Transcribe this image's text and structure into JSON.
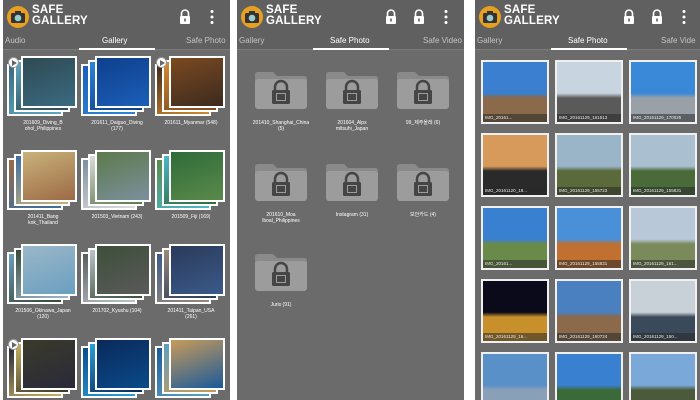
{
  "screens": [
    {
      "app_title": "SAFE\nGALLERY",
      "icons": [
        "app-logo-icon",
        "lock-icon",
        "more-vert-icon"
      ],
      "tabs": [
        "Audio",
        "Gallery",
        "Safe Photo"
      ],
      "active_tab": 1,
      "albums": [
        {
          "caption": "201609_Diving_B\nohol_Philippines",
          "video": true,
          "colors": [
            "#3a6a82",
            "#5fa7c0",
            "#2f4a52"
          ]
        },
        {
          "caption": "201611_Daiguo_Diving\n(177)",
          "video": false,
          "colors": [
            "#1b5fb8",
            "#2b86d6",
            "#0f3f8c"
          ]
        },
        {
          "caption": "201611_Myanmar (548)",
          "video": true,
          "colors": [
            "#3c2a1f",
            "#d48a2e",
            "#7b4a20"
          ]
        },
        {
          "caption": "201411_Bang\nkok_Thailand",
          "video": false,
          "colors": [
            "#9c6a45",
            "#3b6fa0",
            "#c9b27a"
          ]
        },
        {
          "caption": "201503_Vietnam (243)",
          "video": false,
          "colors": [
            "#7c8f9d",
            "#dcdcdc",
            "#5c7a4b"
          ]
        },
        {
          "caption": "201509_Fiji (169)",
          "video": false,
          "colors": [
            "#5a8a4a",
            "#4bb8c8",
            "#2f6b3a"
          ]
        },
        {
          "caption": "201506_Okinawa_Japan\n(120)",
          "video": false,
          "colors": [
            "#6a9fc0",
            "#3a4a3a",
            "#9bb7c8"
          ]
        },
        {
          "caption": "201702_Kyushu (104)",
          "video": false,
          "colors": [
            "#5a5a5a",
            "#b8c4cc",
            "#3d4f3a"
          ]
        },
        {
          "caption": "201411_Taipan_USA\n(261)",
          "video": false,
          "colors": [
            "#3a5a8a",
            "#9a8a7a",
            "#2b3a5a"
          ]
        },
        {
          "caption": "",
          "video": true,
          "colors": [
            "#2a2a3a",
            "#c8b060",
            "#3a3a2a"
          ]
        },
        {
          "caption": "",
          "video": false,
          "colors": [
            "#0a4a8a",
            "#2aa0d8",
            "#0a2a5a"
          ]
        },
        {
          "caption": "",
          "video": false,
          "colors": [
            "#1a5a9a",
            "#5aa0c0",
            "#c89a5a"
          ]
        }
      ]
    },
    {
      "app_title": "SAFE\nGALLERY",
      "icons": [
        "app-logo-icon",
        "lock-icon",
        "lock-icon",
        "more-vert-icon"
      ],
      "tabs": [
        "Gallery",
        "Safe Photo",
        "Safe Video"
      ],
      "active_tab": 1,
      "folders": [
        {
          "caption": "201410_Shanghai_China\n(5)"
        },
        {
          "caption": "201604_Alps\nmitsuhi_Japan"
        },
        {
          "caption": "99_제주올레 (6)"
        },
        {
          "caption": "201610_Moa\nlboal_Philippines"
        },
        {
          "caption": "Instagram (31)"
        },
        {
          "caption": "보안카드 (4)"
        },
        {
          "caption": "Juris (91)"
        }
      ]
    },
    {
      "app_title": "SAFE\nGALLERY",
      "icons": [
        "app-logo-icon",
        "lock-icon",
        "lock-icon",
        "more-vert-icon"
      ],
      "tabs": [
        "Gallery",
        "Safe Photo",
        "Safe Vide"
      ],
      "active_tab": 1,
      "photos": [
        {
          "label": "IMG_20161...",
          "sky": "#3a7fd0",
          "ground": "#8a6a4a"
        },
        {
          "label": "IMG_20161129_161513",
          "sky": "#c8d4e0",
          "ground": "#5a5a5a"
        },
        {
          "label": "IMG_20161129_170025",
          "sky": "#3a88d8",
          "ground": "#9aa0a8"
        },
        {
          "label": "IMG_20161120_18...",
          "sky": "#d89a5a",
          "ground": "#2a2a2a"
        },
        {
          "label": "IMG_20161129_155723",
          "sky": "#9ab4c8",
          "ground": "#5a6a3a"
        },
        {
          "label": "IMG_20161129_155831",
          "sky": "#aac0d0",
          "ground": "#4a6a3a"
        },
        {
          "label": "IMG_20161...",
          "sky": "#3a80d0",
          "ground": "#6a8a4a"
        },
        {
          "label": "IMG_20161129_155831",
          "sky": "#4a90d8",
          "ground": "#c07030"
        },
        {
          "label": "IMG_20161129_161...",
          "sky": "#b8c8d8",
          "ground": "#7a8a5a"
        },
        {
          "label": "IMG_20161129_16...",
          "sky": "#0a0a1a",
          "ground": "#c8902a"
        },
        {
          "label": "IMG_20161129_160724",
          "sky": "#4a80c0",
          "ground": "#8a6a4a"
        },
        {
          "label": "IMG_20161129_150...",
          "sky": "#c8d0d8",
          "ground": "#3a4a5a"
        },
        {
          "label": "",
          "sky": "#5a90c8",
          "ground": "#8aa0b8"
        },
        {
          "label": "",
          "sky": "#3a80d0",
          "ground": "#3a6a3a"
        },
        {
          "label": "",
          "sky": "#7aa8d8",
          "ground": "#4a5a3a"
        }
      ]
    }
  ]
}
